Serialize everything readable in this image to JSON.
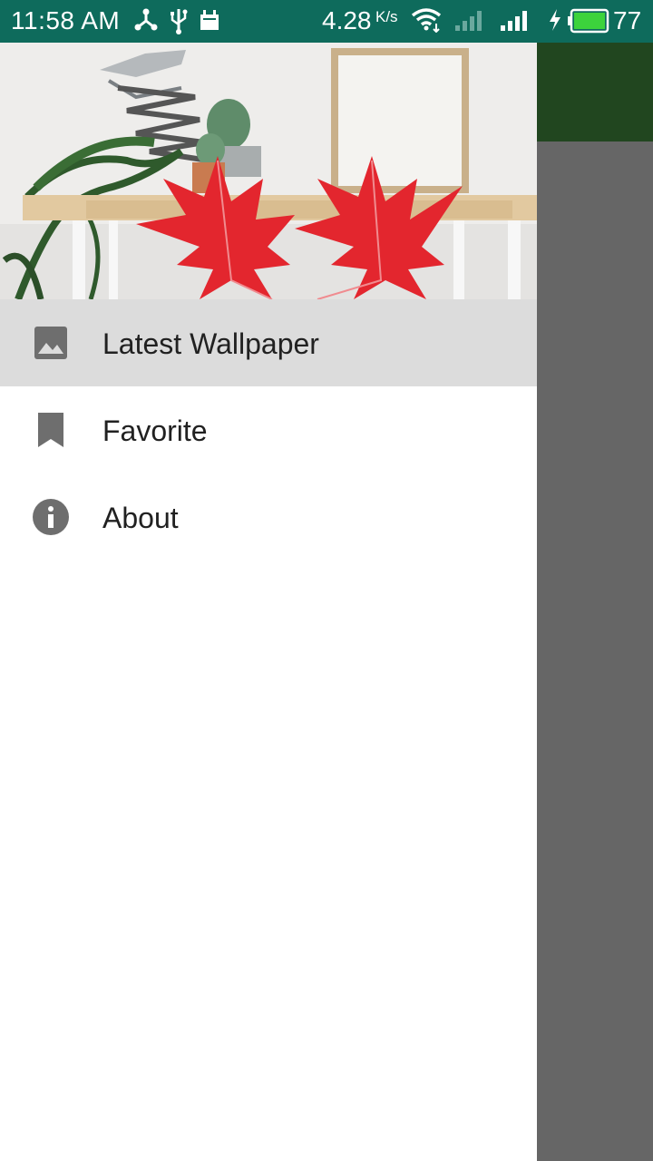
{
  "status_bar": {
    "time": "11:58 AM",
    "net_speed": "4.28",
    "net_speed_unit": "K/s",
    "battery": "77",
    "icons": [
      "share-icon",
      "usb-icon",
      "notification-icon",
      "wifi-icon",
      "signal-empty-icon",
      "signal-icon",
      "charging-icon",
      "battery-icon"
    ]
  },
  "drawer": {
    "header_image": "maple-leaves-desk-image",
    "items": [
      {
        "label": "Latest Wallpaper",
        "icon": "image-icon",
        "selected": true
      },
      {
        "label": "Favorite",
        "icon": "bookmark-icon",
        "selected": false
      },
      {
        "label": "About",
        "icon": "info-icon",
        "selected": false
      }
    ]
  },
  "colors": {
    "status_bar": "#0e6b5c",
    "app_toolbar": "#21461f",
    "scrim": "#666666",
    "selected_item": "#dcdcdc",
    "icon": "#6e6e6e",
    "leaf": "#e3262e",
    "battery_fill": "#3cd33c"
  }
}
